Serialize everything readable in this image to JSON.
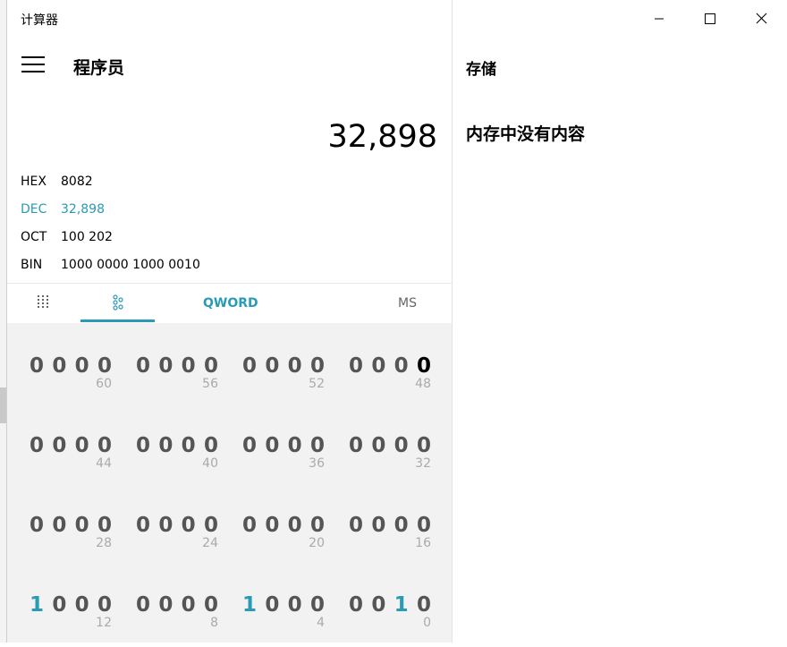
{
  "app": {
    "title": "计算器",
    "mode": "程序员"
  },
  "display": {
    "value": "32,898"
  },
  "radix": [
    {
      "label": "HEX",
      "value": "8082",
      "active": false
    },
    {
      "label": "DEC",
      "value": "32,898",
      "active": true
    },
    {
      "label": "OCT",
      "value": "100 202",
      "active": false
    },
    {
      "label": "BIN",
      "value": "1000 0000 1000 0010",
      "active": false
    }
  ],
  "toolbar": {
    "word_size": "QWORD",
    "ms": "MS",
    "keypad_icon": "full-keypad-icon",
    "bits_icon": "bit-toggling-keypad-icon"
  },
  "bits": [
    {
      "digits": [
        "0",
        "0",
        "0",
        "0"
      ],
      "pos": "60"
    },
    {
      "digits": [
        "0",
        "0",
        "0",
        "0"
      ],
      "pos": "56"
    },
    {
      "digits": [
        "0",
        "0",
        "0",
        "0"
      ],
      "pos": "52"
    },
    {
      "digits": [
        "0",
        "0",
        "0",
        "0"
      ],
      "pos": "48"
    },
    {
      "digits": [
        "0",
        "0",
        "0",
        "0"
      ],
      "pos": "44"
    },
    {
      "digits": [
        "0",
        "0",
        "0",
        "0"
      ],
      "pos": "40"
    },
    {
      "digits": [
        "0",
        "0",
        "0",
        "0"
      ],
      "pos": "36"
    },
    {
      "digits": [
        "0",
        "0",
        "0",
        "0"
      ],
      "pos": "32"
    },
    {
      "digits": [
        "0",
        "0",
        "0",
        "0"
      ],
      "pos": "28"
    },
    {
      "digits": [
        "0",
        "0",
        "0",
        "0"
      ],
      "pos": "24"
    },
    {
      "digits": [
        "0",
        "0",
        "0",
        "0"
      ],
      "pos": "20"
    },
    {
      "digits": [
        "0",
        "0",
        "0",
        "0"
      ],
      "pos": "16"
    },
    {
      "digits": [
        "1",
        "0",
        "0",
        "0"
      ],
      "pos": "12"
    },
    {
      "digits": [
        "0",
        "0",
        "0",
        "0"
      ],
      "pos": "8"
    },
    {
      "digits": [
        "1",
        "0",
        "0",
        "0"
      ],
      "pos": "4"
    },
    {
      "digits": [
        "0",
        "0",
        "1",
        "0"
      ],
      "pos": "0"
    }
  ],
  "memory": {
    "title": "存储",
    "empty_text": "内存中没有内容"
  },
  "window_controls": {
    "minimize_icon": "minimize-icon",
    "maximize_icon": "maximize-icon",
    "close_icon": "close-icon"
  },
  "colors": {
    "accent": "#2a9bb6",
    "bit_area_bg": "#f2f2f2",
    "bit_zero": "#555555",
    "bit_pos": "#aaaaaa"
  }
}
